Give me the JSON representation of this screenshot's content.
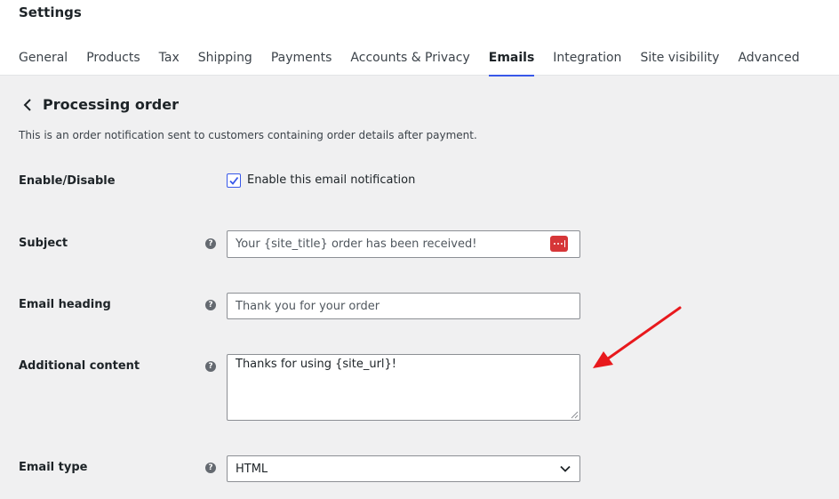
{
  "header": {
    "title": "Settings",
    "tabs": [
      {
        "label": "General"
      },
      {
        "label": "Products"
      },
      {
        "label": "Tax"
      },
      {
        "label": "Shipping"
      },
      {
        "label": "Payments"
      },
      {
        "label": "Accounts & Privacy"
      },
      {
        "label": "Emails"
      },
      {
        "label": "Integration"
      },
      {
        "label": "Site visibility"
      },
      {
        "label": "Advanced"
      }
    ],
    "active_tab": "Emails"
  },
  "page": {
    "heading": "Processing order",
    "description": "This is an order notification sent to customers containing order details after payment."
  },
  "form": {
    "enable": {
      "label": "Enable/Disable",
      "checkbox_label": "Enable this email notification",
      "checked": true
    },
    "subject": {
      "label": "Subject",
      "placeholder": "Your {site_title} order has been received!"
    },
    "heading": {
      "label": "Email heading",
      "placeholder": "Thank you for your order"
    },
    "additional": {
      "label": "Additional content",
      "value": "Thanks for using {site_url}!"
    },
    "email_type": {
      "label": "Email type",
      "selected": "HTML"
    },
    "help_glyph": "?"
  },
  "colors": {
    "accent": "#3858e9",
    "annotation_arrow": "#e8191d",
    "password_badge": "#d63638"
  }
}
